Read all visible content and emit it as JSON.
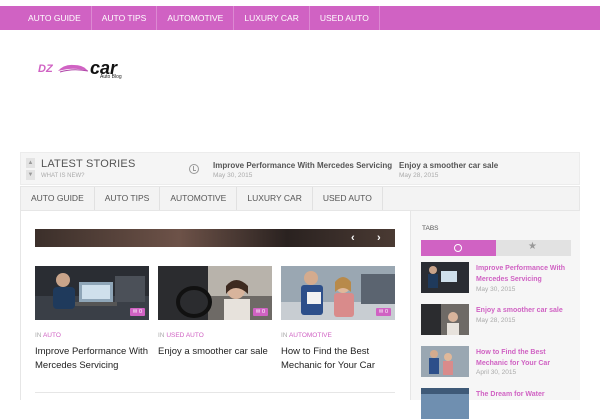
{
  "top_nav": [
    "AUTO GUIDE",
    "AUTO TIPS",
    "AUTOMOTIVE",
    "LUXURY CAR",
    "USED AUTO"
  ],
  "logo": {
    "dz": "DZ",
    "car": "car",
    "tagline": "Auto Blog"
  },
  "latest_stories": {
    "title": "LATEST STORIES",
    "subtitle": "WHAT IS NEW?",
    "items": [
      {
        "title": "Improve Performance With Mercedes Servicing",
        "date": "May 30, 2015"
      },
      {
        "title": "Enjoy a smoother car sale",
        "date": "May 28, 2015"
      }
    ]
  },
  "main_nav": [
    "AUTO GUIDE",
    "AUTO TIPS",
    "AUTOMOTIVE",
    "LUXURY CAR",
    "USED AUTO"
  ],
  "hero": {
    "prev": "‹",
    "next": "›"
  },
  "cards": [
    {
      "in": "IN",
      "category": "AUTO",
      "title": "Improve Performance With Mercedes Servicing",
      "comments": "0"
    },
    {
      "in": "IN",
      "category": "USED AUTO",
      "title": "Enjoy a smoother car sale",
      "comments": "0"
    },
    {
      "in": "IN",
      "category": "AUTOMOTIVE",
      "title": "How to Find the Best Mechanic for Your Car",
      "comments": "0"
    }
  ],
  "sidebar": {
    "label": "TABS",
    "posts": [
      {
        "title": "Improve Performance With Mercedes Servicing",
        "date": "May 30, 2015"
      },
      {
        "title": "Enjoy a smoother car sale",
        "date": "May 28, 2015"
      },
      {
        "title": "How to Find the Best Mechanic for Your Car",
        "date": "April 30, 2015"
      },
      {
        "title": "The Dream for Water",
        "date": ""
      }
    ]
  },
  "colors": {
    "accent": "#d062c3"
  }
}
